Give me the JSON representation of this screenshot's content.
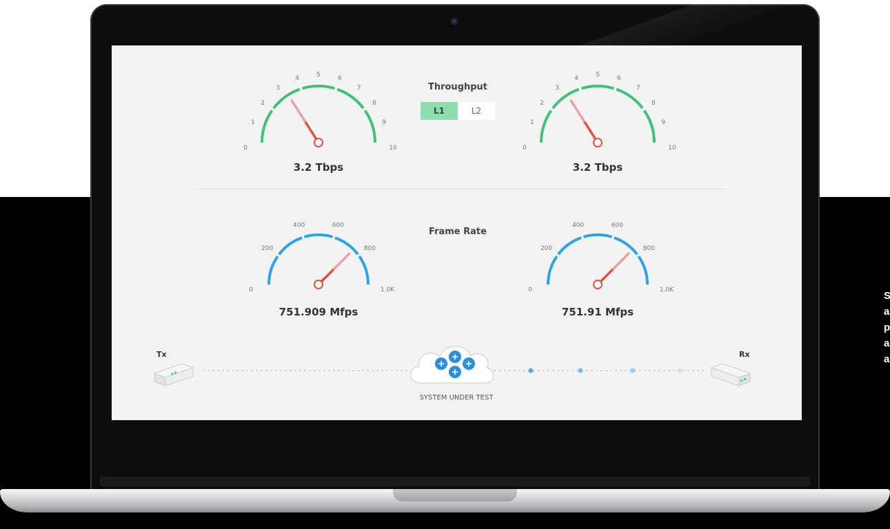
{
  "throughput": {
    "title": "Throughput",
    "toggle": {
      "options": [
        "L1",
        "L2"
      ],
      "selected": "L1"
    },
    "gauge_ticks": [
      "0",
      "1",
      "2",
      "3",
      "4",
      "5",
      "6",
      "7",
      "8",
      "9",
      "10"
    ],
    "tx_value": "3.2 Tbps",
    "rx_value": "3.2 Tbps",
    "needle_fraction": 0.32
  },
  "frame_rate": {
    "title": "Frame Rate",
    "gauge_ticks": [
      "0",
      "200",
      "400",
      "600",
      "800",
      "1.0K"
    ],
    "tx_value": "751.909 Mfps",
    "rx_value": "751.91 Mfps",
    "needle_fraction": 0.75
  },
  "topology": {
    "tx_label": "Tx",
    "rx_label": "Rx",
    "sut_label": "SYSTEM UNDER TEST"
  },
  "side_text_letters": [
    "S",
    "a",
    "p",
    "a",
    "a"
  ],
  "colors": {
    "throughput_arc": "#3ec27a",
    "frame_rate_arc": "#2aa3e8",
    "needle": "#e4503a",
    "needle_light": "#e8a0a0",
    "toggle_active": "#8fdcae",
    "screen_bg": "#f3f3f3"
  },
  "icons": {
    "sut": "cloud-router-icon",
    "tx_device": "server-device-icon",
    "rx_device": "server-device-icon",
    "camera": "camera-icon"
  }
}
